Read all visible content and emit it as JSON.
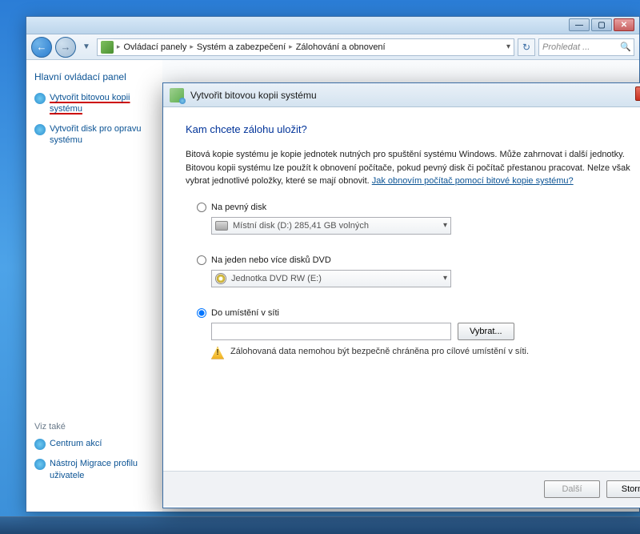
{
  "backWindow": {
    "breadcrumb": [
      "Ovládací panely",
      "Systém a zabezpečení",
      "Zálohování a obnovení"
    ],
    "searchPlaceholder": "Prohledat ...",
    "sidebar": {
      "heading": "Hlavní ovládací panel",
      "links": [
        {
          "label": "Vytvořit bitovou kopii systému",
          "active": true
        },
        {
          "label": "Vytvořit disk pro opravu systému",
          "active": false
        }
      ],
      "seeAlso": "Viz také",
      "seeAlsoLinks": [
        {
          "label": "Centrum akcí"
        },
        {
          "label": "Nástroj Migrace profilu uživatele"
        }
      ]
    }
  },
  "dialog": {
    "title": "Vytvořit bitovou kopii systému",
    "heading": "Kam chcete zálohu uložit?",
    "description": "Bitová kopie systému je kopie jednotek nutných pro spuštění systému Windows. Může zahrnovat i další jednotky. Bitovou kopii systému lze použít k obnovení počítače, pokud pevný disk či počítač přestanou pracovat. Nelze však vybrat jednotlivé položky, které se mají obnovit. ",
    "helpLink": "Jak obnovím počítač pomocí bitové kopie systému?",
    "options": {
      "hdd": {
        "label": "Na pevný disk",
        "value": "Místní disk (D:)  285,41 GB volných"
      },
      "dvd": {
        "label": "Na jeden nebo více disků DVD",
        "value": "Jednotka DVD RW (E:)"
      },
      "net": {
        "label": "Do umístění v síti",
        "browse": "Vybrat...",
        "warning": "Zálohovaná data nemohou být bezpečně chráněna pro cílové umístění v síti."
      }
    },
    "buttons": {
      "next": "Další",
      "cancel": "Storno"
    }
  }
}
